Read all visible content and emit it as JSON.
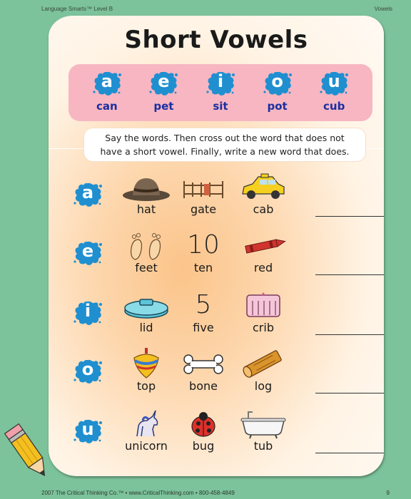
{
  "header": {
    "left": "Language Smarts™ Level B",
    "right": "Vowels"
  },
  "title": "Short Vowels",
  "vowels": [
    {
      "letter": "a",
      "word": "can"
    },
    {
      "letter": "e",
      "word": "pet"
    },
    {
      "letter": "i",
      "word": "sit"
    },
    {
      "letter": "o",
      "word": "pot"
    },
    {
      "letter": "u",
      "word": "cub"
    }
  ],
  "instructions": {
    "line1": "Say the words. Then cross out the word that does not",
    "line2": "have a short vowel. Finally, write a new word that does."
  },
  "rows": [
    {
      "vowel": "a",
      "words": [
        "hat",
        "gate",
        "cab"
      ]
    },
    {
      "vowel": "e",
      "words": [
        "feet",
        "ten",
        "red"
      ],
      "ten_numeral": "10"
    },
    {
      "vowel": "i",
      "words": [
        "lid",
        "five",
        "crib"
      ],
      "five_numeral": "5"
    },
    {
      "vowel": "o",
      "words": [
        "top",
        "bone",
        "log"
      ]
    },
    {
      "vowel": "u",
      "words": [
        "unicorn",
        "bug",
        "tub"
      ]
    }
  ],
  "footer": {
    "left": "2007 The Critical Thinking Co.™ • www.CriticalThinking.com • 800-458-4849",
    "page_number": "9"
  },
  "colors": {
    "background": "#7cc29a",
    "splat": "#1f8fd0",
    "vowel_bar": "#f7b6c2",
    "vowel_word": "#1a2fa0"
  },
  "icons": [
    "hat-icon",
    "gate-icon",
    "taxi-cab-icon",
    "feet-icon",
    "crayon-icon",
    "lid-icon",
    "crib-icon",
    "spinning-top-icon",
    "bone-icon",
    "log-icon",
    "unicorn-icon",
    "ladybug-icon",
    "bathtub-icon",
    "pencil-icon"
  ]
}
